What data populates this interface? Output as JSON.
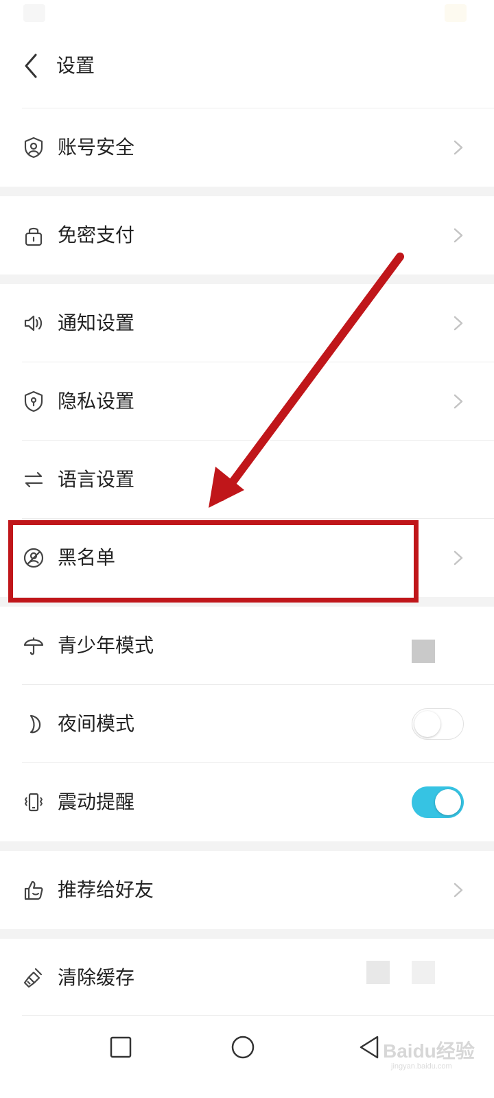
{
  "header": {
    "title": "设置",
    "back_icon": "chevron-left-icon"
  },
  "settings": [
    {
      "key": "account",
      "label": "账号安全",
      "icon": "shield-user-icon",
      "trailing": "chevron"
    },
    {
      "key": "password_free_pay",
      "label": "免密支付",
      "icon": "lock-icon",
      "trailing": "chevron"
    },
    {
      "key": "notifications",
      "label": "通知设置",
      "icon": "speaker-icon",
      "trailing": "chevron"
    },
    {
      "key": "privacy",
      "label": "隐私设置",
      "icon": "shield-keyhole-icon",
      "trailing": "chevron"
    },
    {
      "key": "language",
      "label": "语言设置",
      "icon": "swap-arrows-icon",
      "trailing": "none"
    },
    {
      "key": "blacklist",
      "label": "黑名单",
      "icon": "blocked-user-icon",
      "trailing": "chevron"
    },
    {
      "key": "teen_mode",
      "label": "青少年模式",
      "icon": "umbrella-icon",
      "trailing": "placeholder"
    },
    {
      "key": "night_mode",
      "label": "夜间模式",
      "icon": "moon-icon",
      "trailing": "toggle",
      "toggle_on": false
    },
    {
      "key": "vibration",
      "label": "震动提醒",
      "icon": "vibrate-icon",
      "trailing": "toggle",
      "toggle_on": true
    },
    {
      "key": "recommend",
      "label": "推荐给好友",
      "icon": "thumbs-up-icon",
      "trailing": "chevron"
    },
    {
      "key": "clear_cache",
      "label": "清除缓存",
      "icon": "broom-icon",
      "trailing": "placeholder"
    }
  ],
  "annotation": {
    "highlighted_item": "黑名单",
    "color": "#c0161a"
  },
  "nav_bar": {
    "recent_icon": "square-icon",
    "home_icon": "circle-icon",
    "back_icon": "triangle-back-icon"
  },
  "watermark": {
    "text": "Baidu经验",
    "sub": "jingyan.baidu.com"
  },
  "colors": {
    "toggle_on": "#36c3e3",
    "section_gap": "#f3f3f3",
    "text": "#222222",
    "icon": "#444444",
    "chevron": "#c4c4c4"
  }
}
